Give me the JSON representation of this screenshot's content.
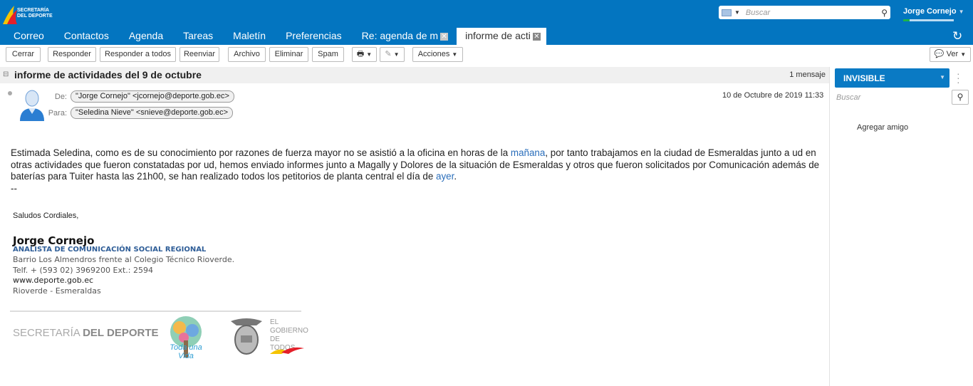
{
  "app": {
    "logo_text": "SECRETARÍA DEL DEPORTE"
  },
  "search": {
    "placeholder": "Buscar"
  },
  "user": {
    "name": "Jorge Cornejo"
  },
  "tabs": [
    {
      "label": "Correo"
    },
    {
      "label": "Contactos"
    },
    {
      "label": "Agenda"
    },
    {
      "label": "Tareas"
    },
    {
      "label": "Maletín"
    },
    {
      "label": "Preferencias"
    },
    {
      "label": "Re: agenda de m"
    },
    {
      "label": "informe de acti"
    }
  ],
  "toolbar": {
    "close": "Cerrar",
    "reply": "Responder",
    "reply_all": "Responder a todos",
    "forward": "Reenviar",
    "archive": "Archivo",
    "delete": "Eliminar",
    "spam": "Spam",
    "actions": "Acciones",
    "view": "Ver"
  },
  "conversation": {
    "subject": "informe de actividades del 9 de octubre",
    "count": "1 mensaje"
  },
  "message": {
    "from_label": "De:",
    "from": "\"Jorge Cornejo\" <jcornejo@deporte.gob.ec>",
    "to_label": "Para:",
    "to": "\"Seledina Nieve\" <snieve@deporte.gob.ec>",
    "date": "10 de Octubre de 2019 11:33",
    "body": {
      "p1": "Estimada Seledina, como es de su conocimiento por razones de fuerza mayor no se asistió a la oficina en horas de la ",
      "link1": "mañana",
      "p2": ", por tanto trabajamos en la ciudad de Esmeraldas junto a ud en otras actividades que fueron constatadas por ud, hemos enviado informes junto a Magally y Dolores de la situación de Esmeraldas y otros que fueron solicitados por Comunicación además de baterías para Tuiter hasta las 21h00, se han realizado todos los petitorios de planta central el día de ",
      "link2": "ayer",
      "p3": ".",
      "sep": "--"
    },
    "signature": {
      "greeting": "Saludos Cordiales,",
      "name": "Jorge Cornejo",
      "title": "ANALISTA DE COMUNICACIÓN SOCIAL REGIONAL",
      "address": "Barrio Los Almendros frente al Colegio Técnico Rioverde.",
      "phone": "Telf. + (593 02) 3969200 Ext.: 2594",
      "web": "www.deporte.gob.ec",
      "city": "Rioverde - Esmeraldas",
      "logo1_a": "SECRETARÍA",
      "logo1_b": "DEL DEPORTE",
      "logo2": "Toda una Vida",
      "logo3": "EL GOBIERNO DE TODOS"
    }
  },
  "sidebar": {
    "status": "INVISIBLE",
    "search_placeholder": "Buscar",
    "add_friend": "Agregar amigo"
  }
}
